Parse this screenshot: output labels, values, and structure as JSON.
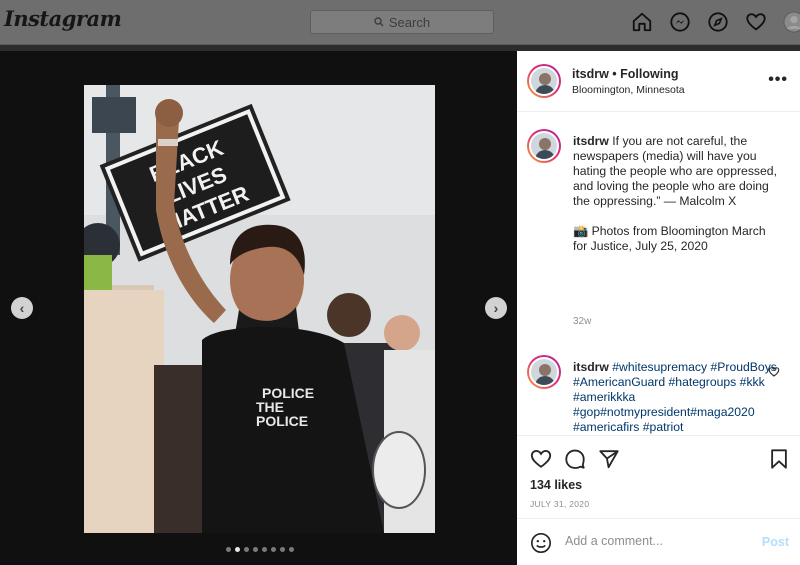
{
  "app": {
    "logo": "Instagram"
  },
  "search": {
    "placeholder": "Search"
  },
  "nav": {
    "icons": [
      "home-icon",
      "messenger-icon",
      "explore-icon",
      "heart-icon",
      "profile-avatar"
    ]
  },
  "post": {
    "username": "itsdrw",
    "follow_status": "• Following",
    "location": "Bloomington, Minnesota",
    "more_label": "•••",
    "caption": {
      "username": "itsdrw",
      "text": "If you are not careful, the newspapers (media) will have you hating the people who are oppressed, and loving the people who are doing the oppressing.” — Malcolm X",
      "camera_emoji": "📸",
      "text2": "Photos from Bloomington March for Justice, July 25, 2020",
      "age": "32w"
    },
    "comment": {
      "username": "itsdrw",
      "text": "#whitesupremacy #ProudBoys #AmericanGuard #hategroups #kkk #amerikkka #gop#notmypresident#maga2020 #americafirs #patriot #shallnotbeinfringed #patriotic #freedom #donaldtrump #defundthepolice #breonnataylor#dismantlewhitesu"
    },
    "likes": "134 likes",
    "date": "JULY 31, 2020",
    "add_comment_placeholder": "Add a comment...",
    "post_label": "Post",
    "carousel": {
      "total": 8,
      "active_index": 1
    },
    "photo": {
      "sign_text": [
        "BLACK",
        "LIVES",
        "MATTER"
      ],
      "shirt_text": [
        "POLICE",
        "THE",
        "POLICE"
      ]
    }
  }
}
